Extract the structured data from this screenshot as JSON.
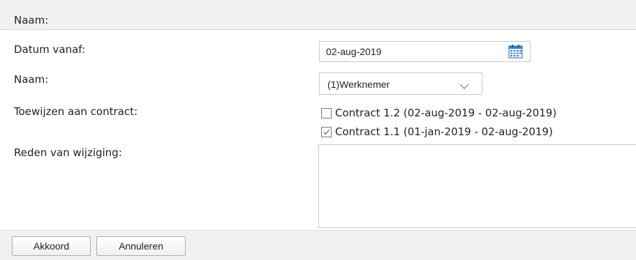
{
  "header": {
    "title": "Naam:"
  },
  "form": {
    "date_label": "Datum vanaf:",
    "date_value": "02-aug-2019",
    "name_label": "Naam:",
    "name_value": "(1)Werknemer",
    "contract_label": "Toewijzen aan contract:",
    "contracts": [
      {
        "label": "Contract 1.2 (02-aug-2019 - 02-aug-2019)",
        "checked": false
      },
      {
        "label": "Contract 1.1 (01-jan-2019 - 02-aug-2019)",
        "checked": true
      }
    ],
    "reason_label": "Reden van wijziging:",
    "reason_value": ""
  },
  "footer": {
    "ok_label": "Akkoord",
    "cancel_label": "Annuleren"
  },
  "icons": {
    "calendar": "calendar-icon",
    "dropdown": "chevron-down-icon",
    "check": "checkmark-icon"
  },
  "colors": {
    "panel_bg": "#f1f1f1",
    "border": "#c9c9c9",
    "calendar_blue": "#3a7fc4"
  }
}
